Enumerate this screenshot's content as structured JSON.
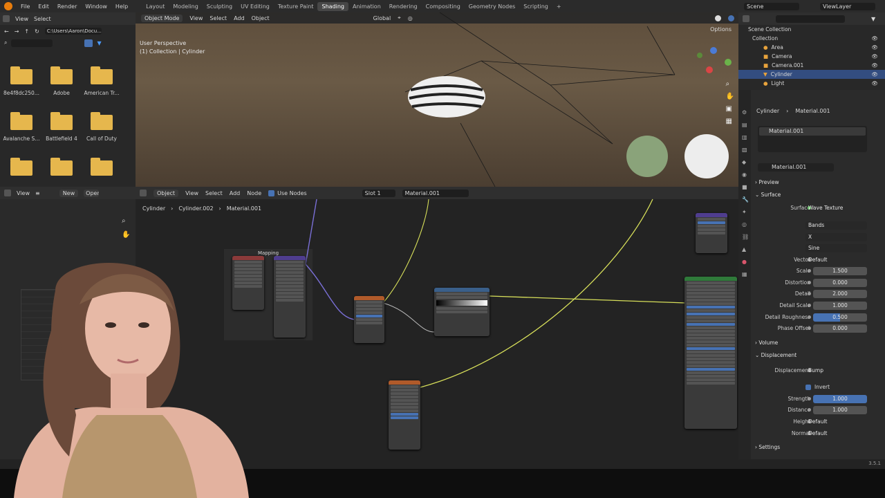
{
  "topbar": {
    "menus": [
      "File",
      "Edit",
      "Render",
      "Window",
      "Help"
    ],
    "workspaces": [
      "Layout",
      "Modeling",
      "Sculpting",
      "UV Editing",
      "Texture Paint",
      "Shading",
      "Animation",
      "Rendering",
      "Compositing",
      "Geometry Nodes",
      "Scripting"
    ],
    "active_workspace": "Shading",
    "scene": "Scene",
    "view_layer": "ViewLayer"
  },
  "filebrowser": {
    "view_menu": "View",
    "select_menu": "Select",
    "path": "C:\\Users\\Aaron\\Docu...",
    "folders": [
      "8e4f8dc250...",
      "Adobe",
      "American Tr...",
      "Avalanche S...",
      "Battlefield 4",
      "Call of Duty",
      "",
      "",
      ""
    ]
  },
  "viewport": {
    "mode": "Object Mode",
    "menus": [
      "View",
      "Select",
      "Add",
      "Object"
    ],
    "orientation": "Global",
    "options": "Options",
    "overlay_title": "User Perspective",
    "overlay_subtitle": "(1) Collection | Cylinder"
  },
  "node_editor": {
    "type": "Object",
    "menus": [
      "View",
      "Select",
      "Add",
      "Node"
    ],
    "use_nodes": "Use Nodes",
    "slot": "Slot 1",
    "material": "Material.001",
    "breadcrumb": [
      "Cylinder",
      "Cylinder.002",
      "Material.001"
    ],
    "frame_label": "Mapping"
  },
  "left_editor": {
    "view_menu": "View",
    "new_button": "New",
    "open_button": "Open"
  },
  "outliner": {
    "root": "Scene Collection",
    "collection": "Collection",
    "items": [
      "Area",
      "Camera",
      "Camera.001",
      "Cylinder",
      "Light"
    ]
  },
  "properties": {
    "breadcrumb_object": "Cylinder",
    "breadcrumb_material": "Material.001",
    "slot_material": "Material.001",
    "material_name": "Material.001",
    "preview": "Preview",
    "surface_section": "Surface",
    "surface_label": "Surface",
    "surface_value": "Wave Texture",
    "bands": "Bands",
    "axis": "X",
    "profile": "Sine",
    "fields": [
      {
        "label": "Vector",
        "value": "Default"
      },
      {
        "label": "Scale",
        "value": "1.500"
      },
      {
        "label": "Distortion",
        "value": "0.000"
      },
      {
        "label": "Detail",
        "value": "2.000"
      },
      {
        "label": "Detail Scale",
        "value": "1.000"
      },
      {
        "label": "Detail Roughness",
        "value": "0.500"
      },
      {
        "label": "Phase Offset",
        "value": "0.000"
      }
    ],
    "volume_section": "Volume",
    "displacement_section": "Displacement",
    "displacement_label": "Displacement",
    "displacement_value": "Bump",
    "invert": "Invert",
    "disp_fields": [
      {
        "label": "Strength",
        "value": "1.000"
      },
      {
        "label": "Distance",
        "value": "1.000"
      },
      {
        "label": "Height",
        "value": "Default"
      },
      {
        "label": "Normal",
        "value": "Default"
      }
    ],
    "settings_section": "Settings"
  },
  "statusbar": {
    "version": "3.5.1"
  },
  "colors": {
    "accent": "#4772b3",
    "folder": "#e6b74d",
    "link_yellow": "#d8e05a",
    "link_purple": "#7a6fd6"
  }
}
